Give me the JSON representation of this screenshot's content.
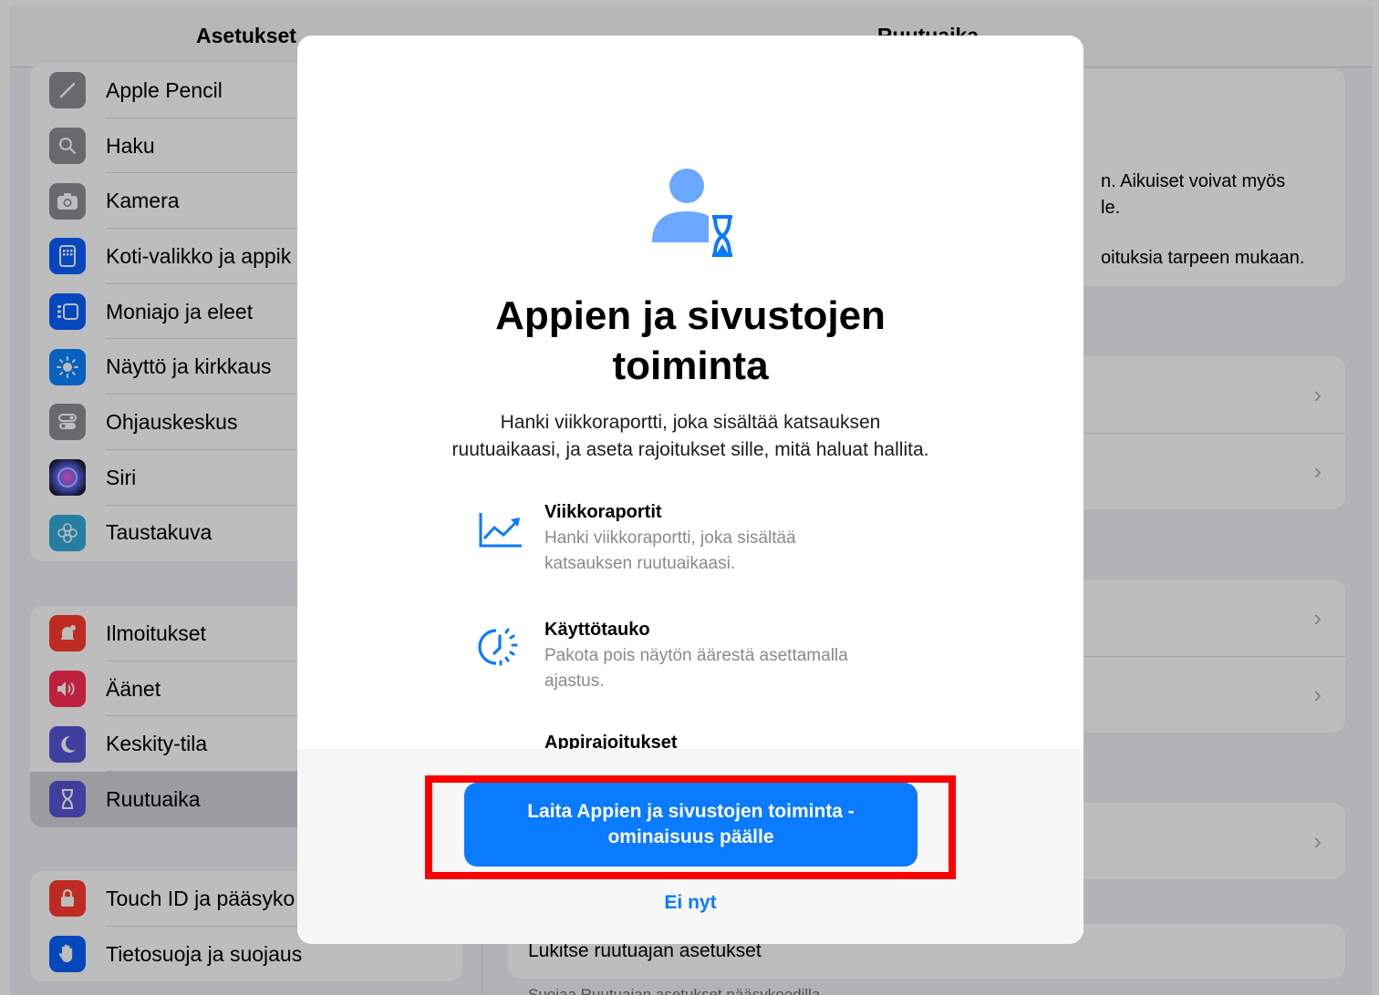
{
  "sidebar": {
    "title": "Asetukset",
    "group1": [
      {
        "label": "Apple Pencil",
        "icon": "pencil-icon",
        "color": "#8e8e93"
      },
      {
        "label": "Haku",
        "icon": "search-icon",
        "color": "#8e8e93"
      },
      {
        "label": "Kamera",
        "icon": "camera-icon",
        "color": "#8e8e93"
      },
      {
        "label": "Koti-valikko ja appik",
        "icon": "home-screen-icon",
        "color": "#0a60ff"
      },
      {
        "label": "Moniajo ja eleet",
        "icon": "multitasking-icon",
        "color": "#0a60ff"
      },
      {
        "label": "Näyttö ja kirkkaus",
        "icon": "brightness-icon",
        "color": "#0a84ff"
      },
      {
        "label": "Ohjauskeskus",
        "icon": "control-center-icon",
        "color": "#8e8e93"
      },
      {
        "label": "Siri",
        "icon": "siri-icon",
        "color": "#1c1c2e"
      },
      {
        "label": "Taustakuva",
        "icon": "wallpaper-icon",
        "color": "#34aadc"
      }
    ],
    "group2": [
      {
        "label": "Ilmoitukset",
        "icon": "notifications-icon",
        "color": "#ff3b30"
      },
      {
        "label": "Äänet",
        "icon": "sounds-icon",
        "color": "#ff2d55"
      },
      {
        "label": "Keskity-tila",
        "icon": "focus-moon-icon",
        "color": "#5856d6"
      },
      {
        "label": "Ruutuaika",
        "icon": "hourglass-icon",
        "color": "#5856d6",
        "selected": true
      }
    ],
    "group3": [
      {
        "label": "Touch ID ja pääsyko",
        "icon": "lock-icon",
        "color": "#ff3b30"
      },
      {
        "label": "Tietosuoja ja suojaus",
        "icon": "privacy-hand-icon",
        "color": "#0a60ff"
      }
    ]
  },
  "main": {
    "title": "Ruutuaika",
    "card_text_1": "n. Aikuiset voivat myös",
    "card_text_2": "le.",
    "card_text_3": "oituksia tarpeen mukaan.",
    "lock_link": "Lukitse ruutuajan asetukset",
    "footer_partial": "Suojaa Ruutuajan asetukset pääsykoodilla"
  },
  "modal": {
    "title_line1": "Appien ja sivustojen",
    "title_line2": "toiminta",
    "description_line1": "Hanki viikkoraportti, joka sisältää katsauksen",
    "description_line2": "ruutuaikaasi, ja aseta rajoitukset sille, mitä haluat hallita.",
    "features": [
      {
        "title": "Viikkoraportit",
        "text": "Hanki viikkoraportti, joka sisältää katsauksen ruutuaikaasi.",
        "icon": "chart-trend-icon"
      },
      {
        "title": "Käyttötauko",
        "text": "Pakota pois näytön äärestä asettamalla ajastus.",
        "icon": "downtime-clock-icon"
      }
    ],
    "clipped_feature_title": "Appirajoitukset",
    "primary_button_label": "Laita Appien ja sivustojen toiminta -ominaisuus päälle",
    "secondary_button_label": "Ei nyt",
    "accent": "#0a7aff"
  },
  "annotation": {
    "highlight_color": "#ff0000"
  }
}
